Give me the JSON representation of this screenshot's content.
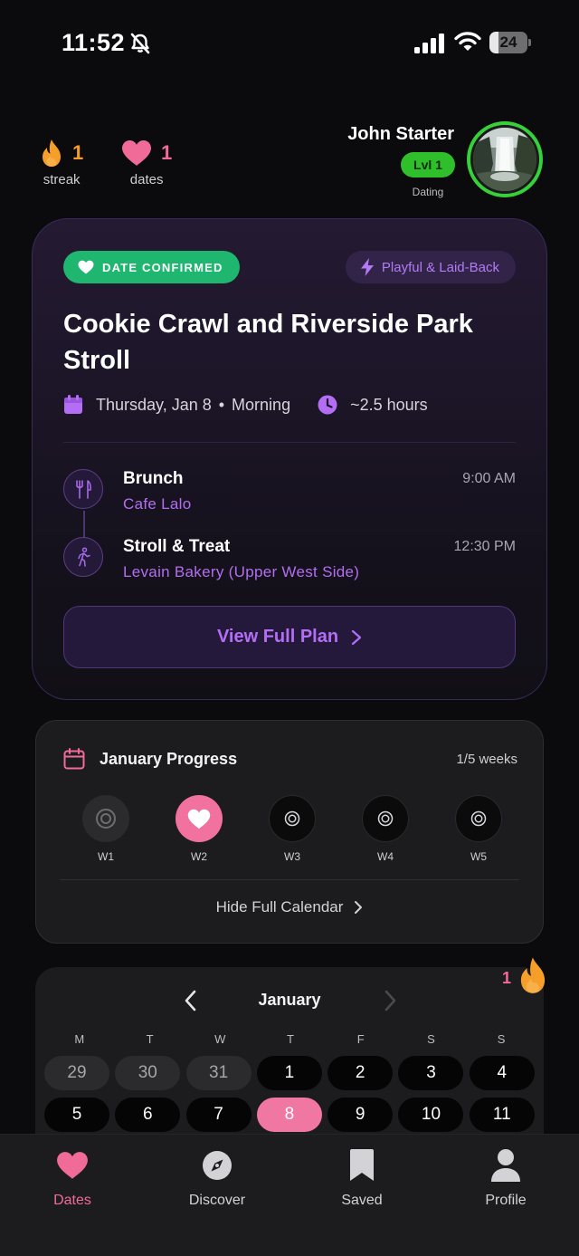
{
  "status_bar": {
    "time": "11:52",
    "battery": "24",
    "battery_level": 0.24
  },
  "header": {
    "streak": {
      "value": "1",
      "label": "streak"
    },
    "dates": {
      "value": "1",
      "label": "dates"
    },
    "user": {
      "name": "John Starter",
      "level": "Lvl 1",
      "role": "Dating"
    }
  },
  "date_card": {
    "status_label": "DATE CONFIRMED",
    "vibe_label": "Playful & Laid-Back",
    "title": "Cookie Crawl and Riverside Park Stroll",
    "day": "Thursday, Jan 8",
    "time_of_day": "Morning",
    "duration": "~2.5 hours",
    "stops": [
      {
        "name": "Brunch",
        "place": "Cafe Lalo",
        "time": "9:00 AM",
        "icon": "fork-knife-icon"
      },
      {
        "name": "Stroll & Treat",
        "place": "Levain Bakery (Upper West Side)",
        "time": "12:30 PM",
        "icon": "walking-icon"
      }
    ],
    "cta_label": "View Full Plan"
  },
  "progress": {
    "title": "January Progress",
    "count": "1/5 weeks",
    "weeks": [
      {
        "label": "W1",
        "state": "past"
      },
      {
        "label": "W2",
        "state": "done"
      },
      {
        "label": "W3",
        "state": "future"
      },
      {
        "label": "W4",
        "state": "future"
      },
      {
        "label": "W5",
        "state": "future"
      }
    ],
    "toggle_label": "Hide Full Calendar"
  },
  "calendar": {
    "month": "January",
    "weekdays": [
      "M",
      "T",
      "W",
      "T",
      "F",
      "S",
      "S"
    ],
    "days": [
      {
        "label": "29",
        "state": "muted"
      },
      {
        "label": "30",
        "state": "muted"
      },
      {
        "label": "31",
        "state": "muted"
      },
      {
        "label": "1",
        "state": "normal"
      },
      {
        "label": "2",
        "state": "normal"
      },
      {
        "label": "3",
        "state": "normal"
      },
      {
        "label": "4",
        "state": "normal"
      },
      {
        "label": "5",
        "state": "normal"
      },
      {
        "label": "6",
        "state": "normal"
      },
      {
        "label": "7",
        "state": "normal"
      },
      {
        "label": "8",
        "state": "selected"
      },
      {
        "label": "9",
        "state": "normal"
      },
      {
        "label": "10",
        "state": "normal"
      },
      {
        "label": "11",
        "state": "normal"
      }
    ],
    "streak_badge": "1"
  },
  "tabs": [
    {
      "label": "Dates",
      "icon": "heart-icon",
      "active": true
    },
    {
      "label": "Discover",
      "icon": "compass-icon",
      "active": false
    },
    {
      "label": "Saved",
      "icon": "bookmark-icon",
      "active": false
    },
    {
      "label": "Profile",
      "icon": "person-icon",
      "active": false
    }
  ],
  "colors": {
    "accent_purple": "#b46ef6",
    "accent_pink": "#f06b98",
    "confirmed_green": "#1fb66f",
    "streak_orange": "#f59e2a",
    "level_green": "#2fbf2a"
  }
}
